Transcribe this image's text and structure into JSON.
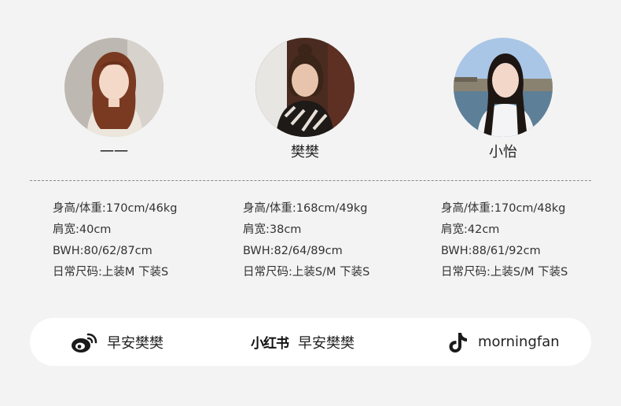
{
  "models": [
    {
      "name": "一一",
      "stats": [
        "身高/体重:170cm/46kg",
        "肩宽:40cm",
        "BWH:80/62/87cm",
        "日常尺码:上装M 下装S"
      ]
    },
    {
      "name": "樊樊",
      "stats": [
        "身高/体重:168cm/49kg",
        "肩宽:38cm",
        "BWH:82/64/89cm",
        "日常尺码:上装S/M 下装S"
      ]
    },
    {
      "name": "小怡",
      "stats": [
        "身高/体重:170cm/48kg",
        "肩宽:42cm",
        "BWH:88/61/92cm",
        "日常尺码:上装S/M 下装S"
      ]
    }
  ],
  "social": {
    "weibo": {
      "icon": "weibo-icon",
      "handle": "早安樊樊"
    },
    "xiaohongshu": {
      "logo": "小红书",
      "handle": "早安樊樊"
    },
    "douyin": {
      "icon": "tiktok-icon",
      "handle": "morningfan"
    }
  },
  "colors": {
    "background": "#f3f3f3",
    "bar": "#ffffff",
    "weibo_red": "#e6162d",
    "weibo_orange": "#f39c12"
  }
}
